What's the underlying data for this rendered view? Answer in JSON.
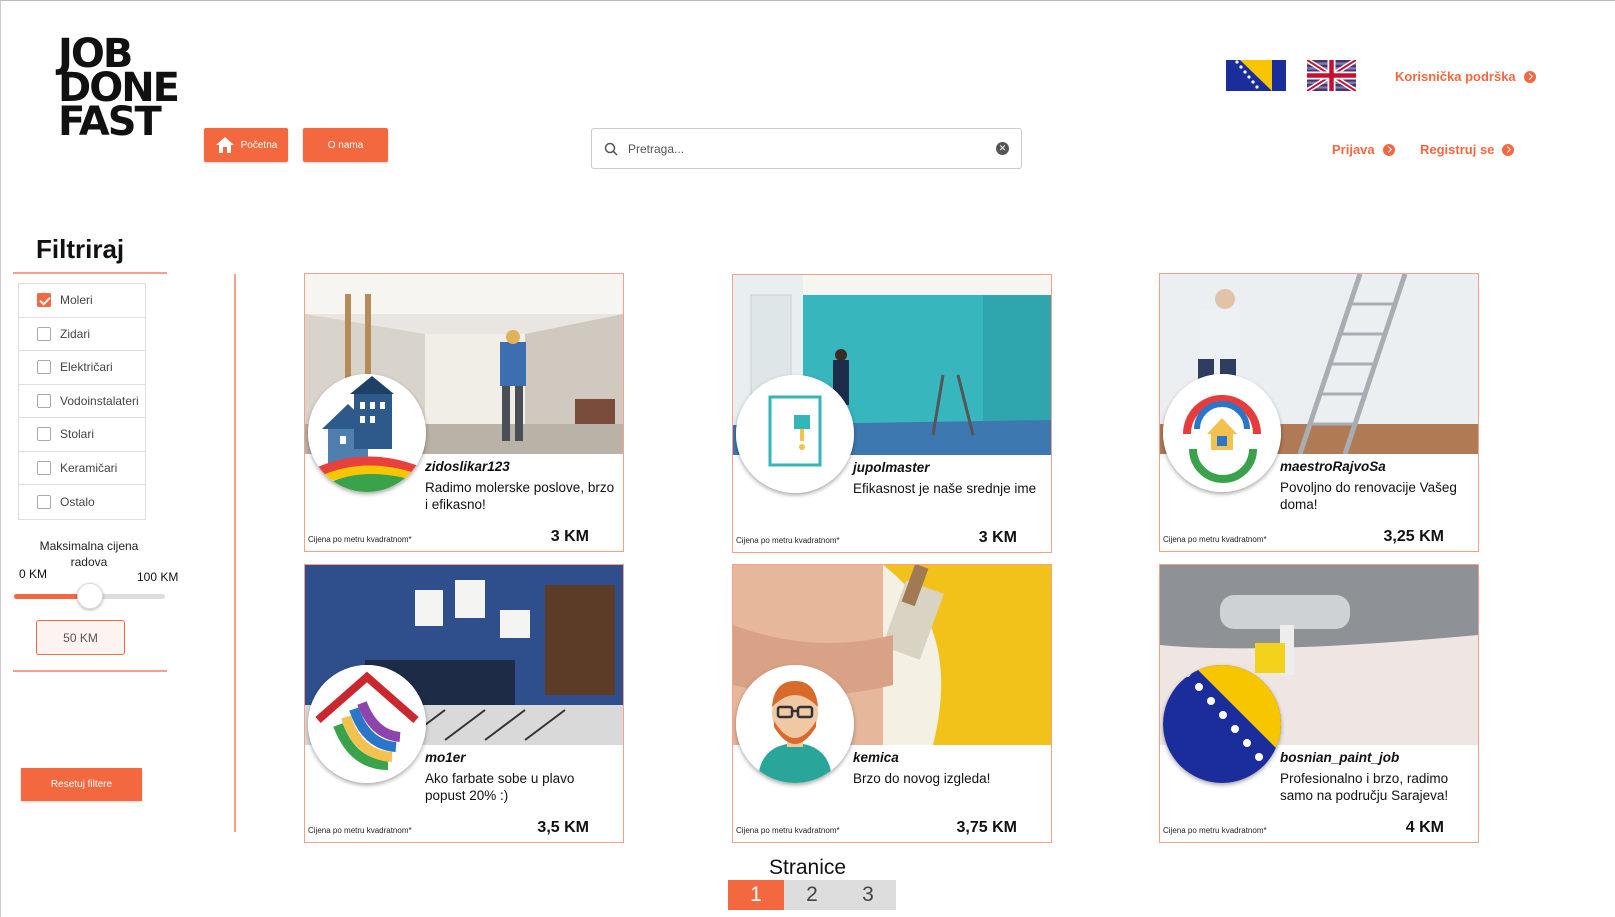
{
  "logo": {
    "line1": "JOB",
    "line2": "DONE",
    "line3": "FAST"
  },
  "nav": {
    "home_label": "Početna",
    "about_label": "O nama"
  },
  "search": {
    "placeholder": "Pretraga..."
  },
  "header_links": {
    "support": "Korisnička podrška",
    "login": "Prijava",
    "register": "Registruj se"
  },
  "filter": {
    "title": "Filtriraj",
    "categories": [
      {
        "label": "Moleri",
        "checked": true
      },
      {
        "label": "Zidari",
        "checked": false
      },
      {
        "label": "Električari",
        "checked": false
      },
      {
        "label": "Vodoinstalateri",
        "checked": false
      },
      {
        "label": "Stolari",
        "checked": false
      },
      {
        "label": "Keramičari",
        "checked": false
      },
      {
        "label": "Ostalo",
        "checked": false
      }
    ],
    "max_price_label": "Maksimalna cijena radova",
    "range_min": "0 KM",
    "range_max": "100 KM",
    "slider_value_fraction": 0.5,
    "current_value": "50 KM",
    "reset_label": "Resetuj filtere"
  },
  "listings": [
    {
      "username": "zidoslikar123",
      "description": "Radimo molerske poslove, brzo i efikasno!",
      "price_label": "Cijena po metru kvadratnom*",
      "price": "3 KM"
    },
    {
      "username": "jupolmaster",
      "description": "Efikasnost je naše srednje ime",
      "price_label": "Cijena po metru kvadratnom*",
      "price": "3 KM"
    },
    {
      "username": "maestroRajvoSa",
      "description": "Povoljno do renovacije Vašeg doma!",
      "price_label": "Cijena po metru kvadratnom*",
      "price": "3,25 KM"
    },
    {
      "username": "mo1er",
      "description": "Ako farbate sobe u plavo popust 20% :)",
      "price_label": "Cijena po metru kvadratnom*",
      "price": "3,5 KM"
    },
    {
      "username": "kemica",
      "description": "Brzo do novog izgleda!",
      "price_label": "Cijena po metru kvadratnom*",
      "price": "3,75 KM"
    },
    {
      "username": "bosnian_paint_job",
      "description": "Profesionalno i brzo, radimo samo na području Sarajeva!",
      "price_label": "Cijena po metru kvadratnom*",
      "price": "4 KM"
    }
  ],
  "pagination": {
    "title": "Stranice",
    "pages": [
      "1",
      "2",
      "3"
    ],
    "active": "1"
  },
  "colors": {
    "accent": "#f4683f",
    "accent_light": "#f4a08a"
  }
}
